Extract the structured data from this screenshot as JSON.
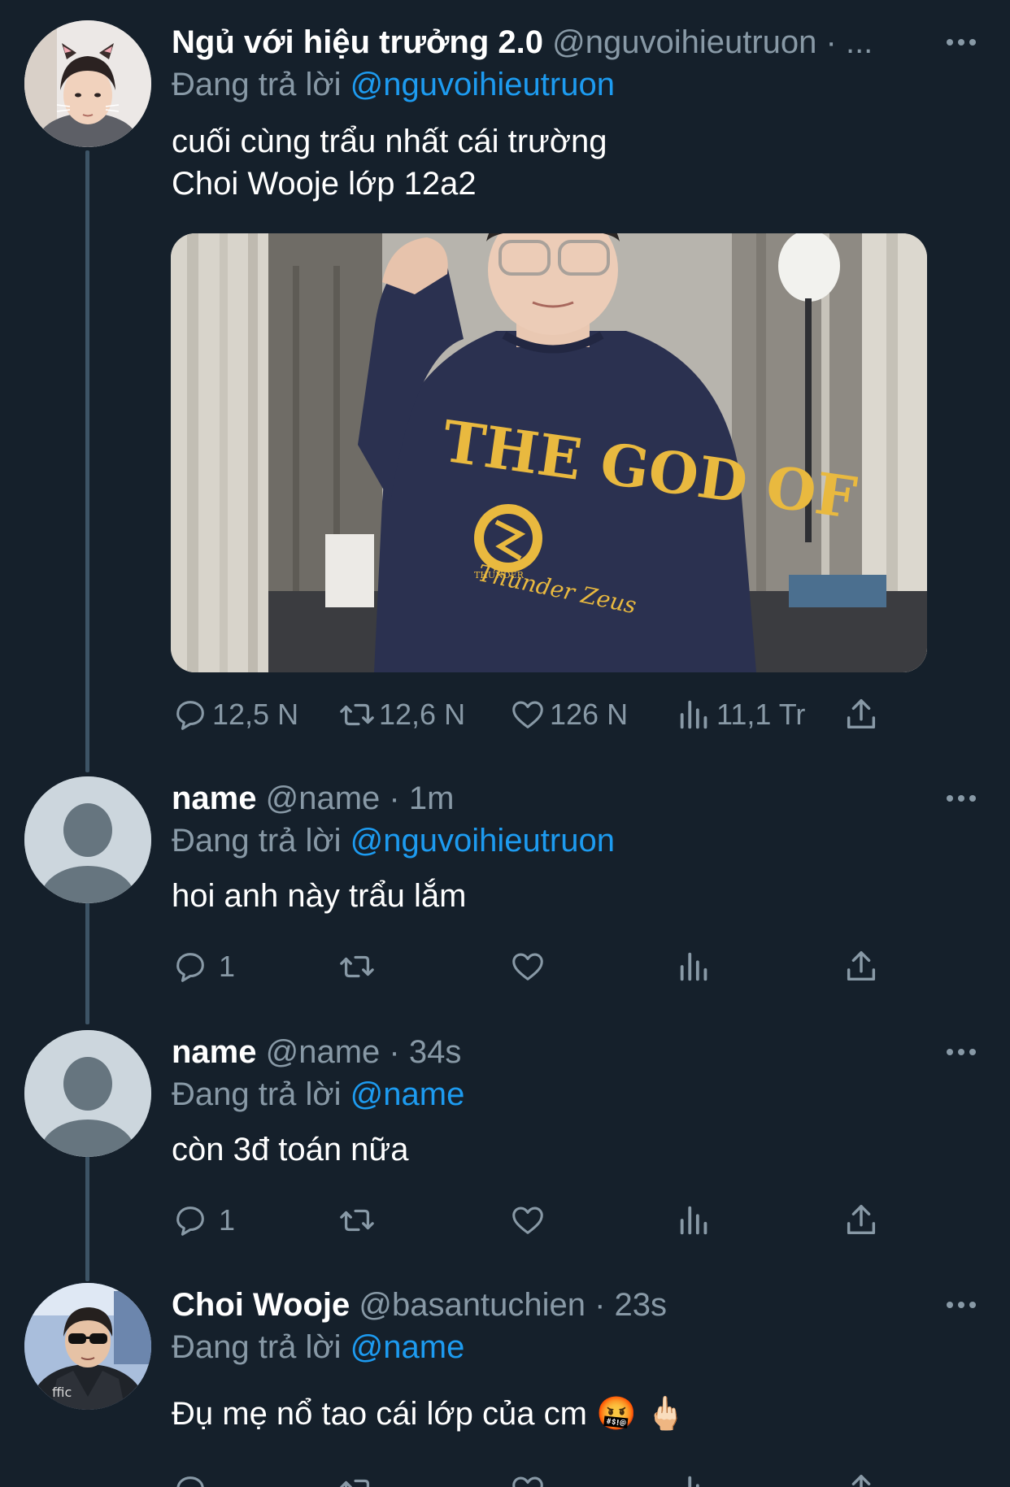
{
  "thread": [
    {
      "display_name": "Ngủ với hiệu trưởng 2.0",
      "handle": "@nguvoihieutruon",
      "meta": " · ...",
      "reply_prefix": "Đang trả lời",
      "reply_to": "@nguvoihieutruon",
      "text": "cuối cùng trẩu nhất cái trường\n Choi Wooje lớp 12a2",
      "media_shirt_text": "THE GOD OF",
      "media_script_text": "Thunder Zeus",
      "media_badge_text": "THUNDER",
      "stats": {
        "replies": "12,5 N",
        "retweets": "12,6 N",
        "likes": "126 N",
        "views": "11,1 Tr"
      }
    },
    {
      "display_name": "name",
      "handle": "@name",
      "meta": " · 1m",
      "reply_prefix": "Đang trả lời",
      "reply_to": "@nguvoihieutruon",
      "text": "hoi anh này trẩu lắm",
      "stats": {
        "replies": "1"
      }
    },
    {
      "display_name": "name",
      "handle": "@name",
      "meta": " · 34s",
      "reply_prefix": "Đang trả lời",
      "reply_to": "@name",
      "text": "còn 3đ toán nữa",
      "stats": {
        "replies": "1"
      }
    },
    {
      "display_name": "Choi Wooje",
      "handle": "@basantuchien",
      "meta": " · 23s",
      "reply_prefix": "Đang trả lời",
      "reply_to": "@name",
      "text": "Đụ mẹ nổ tao cái lớp của cm 🤬 🖕🏻",
      "jersey_text": "ffic"
    }
  ],
  "colors": {
    "background": "#15202b",
    "secondary_text": "#8899a6",
    "link": "#1d9bf0",
    "thread_line": "#3d5466",
    "sweater": "#2b3150",
    "print": "#e9b93f"
  }
}
